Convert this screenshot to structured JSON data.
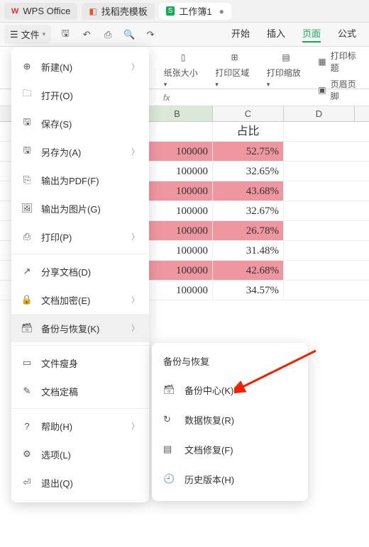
{
  "tabs": [
    {
      "label": "WPS Office",
      "icon": "wps"
    },
    {
      "label": "找稻壳模板",
      "icon": "docshell"
    },
    {
      "label": "工作簿1",
      "icon": "sheet",
      "active": true
    }
  ],
  "toolbar": {
    "file_label": "文件",
    "menu_tabs": [
      "开始",
      "插入",
      "页面",
      "公式"
    ],
    "active_menu": "页面"
  },
  "ribbon": {
    "page_size_label": "纸张大小",
    "print_area_label": "打印区域",
    "print_scale_label": "打印缩放",
    "print_title_label": "打印标题",
    "header_footer_label": "页眉页脚"
  },
  "formula": {
    "fx": "fx"
  },
  "columns": [
    "B",
    "C",
    "D"
  ],
  "header_row": {
    "b": "",
    "c": "占比"
  },
  "data_rows": [
    {
      "b": "100000",
      "c": "52.75%",
      "hl": true
    },
    {
      "b": "100000",
      "c": "32.65%",
      "hl": false
    },
    {
      "b": "100000",
      "c": "43.68%",
      "hl": true
    },
    {
      "b": "100000",
      "c": "32.67%",
      "hl": false
    },
    {
      "b": "100000",
      "c": "26.78%",
      "hl": true
    },
    {
      "b": "100000",
      "c": "31.48%",
      "hl": false
    },
    {
      "b": "100000",
      "c": "42.68%",
      "hl": true
    },
    {
      "b": "100000",
      "c": "34.57%",
      "hl": false
    }
  ],
  "file_menu": [
    {
      "label": "新建(N)",
      "icon": "new",
      "sub": true
    },
    {
      "label": "打开(O)",
      "icon": "open"
    },
    {
      "label": "保存(S)",
      "icon": "save"
    },
    {
      "label": "另存为(A)",
      "icon": "saveas",
      "sub": true
    },
    {
      "label": "输出为PDF(F)",
      "icon": "pdf"
    },
    {
      "label": "输出为图片(G)",
      "icon": "image"
    },
    {
      "label": "打印(P)",
      "icon": "print",
      "sub": true
    },
    {
      "sep": true
    },
    {
      "label": "分享文档(D)",
      "icon": "share"
    },
    {
      "label": "文档加密(E)",
      "icon": "encrypt",
      "sub": true
    },
    {
      "label": "备份与恢复(K)",
      "icon": "backup",
      "sub": true,
      "hover": true
    },
    {
      "sep": true
    },
    {
      "label": "文件瘦身",
      "icon": "slim"
    },
    {
      "label": "文档定稿",
      "icon": "final"
    },
    {
      "sep": true
    },
    {
      "label": "帮助(H)",
      "icon": "help",
      "sub": true
    },
    {
      "label": "选项(L)",
      "icon": "options"
    },
    {
      "label": "退出(Q)",
      "icon": "exit"
    }
  ],
  "sub_menu": {
    "title": "备份与恢复",
    "items": [
      {
        "label": "备份中心(K)",
        "icon": "backup-center"
      },
      {
        "label": "数据恢复(R)",
        "icon": "data-recover"
      },
      {
        "label": "文档修复(F)",
        "icon": "doc-repair"
      },
      {
        "label": "历史版本(H)",
        "icon": "history"
      }
    ]
  }
}
